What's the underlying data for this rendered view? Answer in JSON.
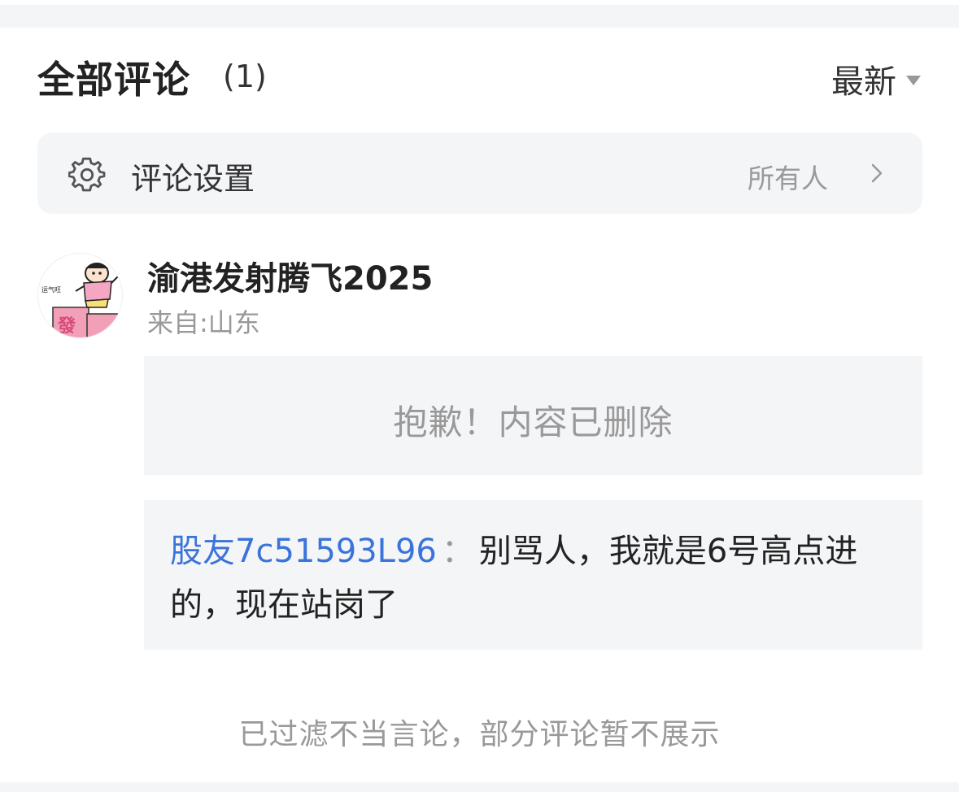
{
  "header": {
    "title": "全部评论",
    "count": "(1)",
    "sort_label": "最新"
  },
  "settings": {
    "label": "评论设置",
    "value": "所有人",
    "icon": "gear-icon"
  },
  "comment": {
    "username": "渝港发射腾飞2025",
    "location": "来自:山东",
    "avatar_caption": "运气旺",
    "avatar_badge": "發",
    "deleted_message": "抱歉！内容已删除",
    "reply": {
      "author": "股友7c51593L96",
      "separator": "：",
      "text": "别骂人，我就是6号高点进的，现在站岗了"
    }
  },
  "footer": {
    "filter_note": "已过滤不当言论，部分评论暂不展示"
  },
  "colors": {
    "accent_link": "#3a73d9",
    "panel_bg": "#f4f5f7",
    "muted_text": "#999999"
  }
}
